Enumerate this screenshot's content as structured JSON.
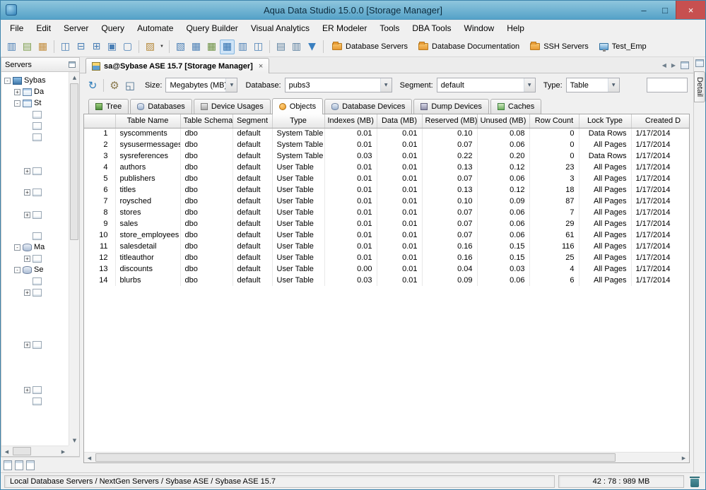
{
  "window": {
    "title": "Aqua Data Studio 15.0.0 [Storage Manager]",
    "controls": {
      "minimize": "–",
      "maximize": "□",
      "close": "×"
    }
  },
  "menubar": [
    "File",
    "Edit",
    "Server",
    "Query",
    "Automate",
    "Query Builder",
    "Visual Analytics",
    "ER Modeler",
    "Tools",
    "DBA Tools",
    "Window",
    "Help"
  ],
  "toolbar": {
    "icons": [
      {
        "name": "register-server-icon",
        "glyph": "▥",
        "color": "#4a7fb5"
      },
      {
        "name": "server-properties-icon",
        "glyph": "▤",
        "color": "#7a9c49"
      },
      {
        "name": "import-servers-icon",
        "glyph": "▦",
        "color": "#c28b3a"
      },
      {
        "name": "separator"
      },
      {
        "name": "cascade-windows-icon",
        "glyph": "◫",
        "color": "#4a7fb5"
      },
      {
        "name": "tile-horizontal-icon",
        "glyph": "⊟",
        "color": "#4a7fb5"
      },
      {
        "name": "tile-vertical-icon",
        "glyph": "⊞",
        "color": "#4a7fb5"
      },
      {
        "name": "expand-window-icon",
        "glyph": "▣",
        "color": "#4a7fb5"
      },
      {
        "name": "restore-window-icon",
        "glyph": "▢",
        "color": "#4a7fb5"
      },
      {
        "name": "separator"
      },
      {
        "name": "paste-icon",
        "glyph": "▨",
        "color": "#b5893c",
        "caret": true
      },
      {
        "name": "separator"
      },
      {
        "name": "query-analyzer-icon",
        "glyph": "▧",
        "color": "#4a7fb5"
      },
      {
        "name": "grid-results-icon",
        "glyph": "▦",
        "color": "#4a7fb5"
      },
      {
        "name": "pivot-grid-icon",
        "glyph": "▦",
        "color": "#6a8f3f"
      },
      {
        "name": "storage-manager-icon",
        "glyph": "▦",
        "color": "#2f6fae",
        "active": true
      },
      {
        "name": "chart-view-icon",
        "glyph": "▥",
        "color": "#4a7fb5"
      },
      {
        "name": "form-view-icon",
        "glyph": "◫",
        "color": "#4a7fb5"
      },
      {
        "name": "separator"
      },
      {
        "name": "row-list-icon",
        "glyph": "▤",
        "color": "#5a7f9f"
      },
      {
        "name": "column-list-icon",
        "glyph": "▥",
        "color": "#5a7f9f"
      },
      {
        "name": "filter-results-icon",
        "glyph": "▼",
        "color": "#3a7fc0"
      },
      {
        "name": "separator"
      }
    ],
    "links": [
      {
        "label": "Database Servers",
        "icon": "folder"
      },
      {
        "label": "Database Documentation",
        "icon": "folder"
      },
      {
        "label": "SSH Servers",
        "icon": "folder"
      },
      {
        "label": "Test_Emp",
        "icon": "monitor"
      }
    ]
  },
  "sidebar": {
    "title": "Servers",
    "tree": [
      {
        "label": "Sybas",
        "icon": "server",
        "expander": "minus",
        "depth": 0,
        "gap": 0
      },
      {
        "label": "Da",
        "icon": "table",
        "expander": "plus",
        "depth": 1,
        "gap": 0
      },
      {
        "label": "St",
        "icon": "table",
        "expander": "minus",
        "depth": 1,
        "gap": 0
      },
      {
        "label": "",
        "icon": "doc",
        "depth": 2,
        "gap": 0
      },
      {
        "label": "",
        "icon": "doc",
        "depth": 2,
        "gap": 0
      },
      {
        "label": "",
        "icon": "doc",
        "depth": 2,
        "gap": 0
      },
      {
        "label": "",
        "icon": "doc",
        "expander": "plus",
        "depth": 2,
        "gap": 32
      },
      {
        "label": "",
        "icon": "doc",
        "expander": "plus",
        "depth": 2,
        "gap": 14
      },
      {
        "label": "",
        "icon": "doc",
        "expander": "plus",
        "depth": 2,
        "gap": 16
      },
      {
        "label": "",
        "icon": "doc",
        "depth": 2,
        "gap": 14
      },
      {
        "label": "Ma",
        "icon": "db",
        "expander": "minus",
        "depth": 1,
        "gap": 0
      },
      {
        "label": "",
        "icon": "doc",
        "expander": "plus",
        "depth": 2,
        "gap": 0
      },
      {
        "label": "Se",
        "icon": "db",
        "expander": "minus",
        "depth": 1,
        "gap": 0
      },
      {
        "label": "",
        "icon": "doc",
        "depth": 2,
        "gap": 0
      },
      {
        "label": "",
        "icon": "doc",
        "expander": "plus",
        "depth": 2,
        "gap": 0
      },
      {
        "label": "",
        "icon": "doc",
        "expander": "plus",
        "depth": 2,
        "gap": 58
      },
      {
        "label": "",
        "icon": "doc",
        "expander": "plus",
        "depth": 2,
        "gap": 48
      },
      {
        "label": "",
        "icon": "doc",
        "depth": 2,
        "gap": 0
      }
    ]
  },
  "doc_tab": {
    "label": "sa@Sybase ASE 15.7 [Storage Manager]",
    "close": "×"
  },
  "controls": {
    "icons": [
      {
        "name": "refresh-icon",
        "glyph": "↻",
        "color": "#2b7bb9"
      },
      {
        "name": "separator"
      },
      {
        "name": "settings-icon",
        "glyph": "⚙",
        "color": "#8a7a4f"
      },
      {
        "name": "copy-grid-icon",
        "glyph": "◱",
        "color": "#4a6f8f"
      }
    ],
    "size_label": "Size:",
    "size_value": "Megabytes (MB)",
    "database_label": "Database:",
    "database_value": "pubs3",
    "segment_label": "Segment:",
    "segment_value": "default",
    "type_label": "Type:",
    "type_value": "Table",
    "filter_value": ""
  },
  "subtabs": [
    {
      "label": "Tree",
      "icon": "tree"
    },
    {
      "label": "Databases",
      "icon": "databases"
    },
    {
      "label": "Device Usages",
      "icon": "devices"
    },
    {
      "label": "Objects",
      "icon": "objects",
      "active": true
    },
    {
      "label": "Database Devices",
      "icon": "db-devices"
    },
    {
      "label": "Dump Devices",
      "icon": "dump"
    },
    {
      "label": "Caches",
      "icon": "caches"
    }
  ],
  "grid": {
    "headers": [
      "",
      "Table Name",
      "Table Schema",
      "Segment",
      "Type",
      "Indexes (MB)",
      "Data (MB)",
      "Reserved (MB)",
      "Unused (MB)",
      "Row Count",
      "Lock Type",
      "Created D"
    ],
    "rows": [
      [
        "1",
        "syscomments",
        "dbo",
        "default",
        "System Table",
        "0.01",
        "0.01",
        "0.10",
        "0.08",
        "0",
        "Data Rows",
        "1/17/2014"
      ],
      [
        "2",
        "sysusermessages",
        "dbo",
        "default",
        "System Table",
        "0.01",
        "0.01",
        "0.07",
        "0.06",
        "0",
        "All Pages",
        "1/17/2014"
      ],
      [
        "3",
        "sysreferences",
        "dbo",
        "default",
        "System Table",
        "0.03",
        "0.01",
        "0.22",
        "0.20",
        "0",
        "Data Rows",
        "1/17/2014"
      ],
      [
        "4",
        "authors",
        "dbo",
        "default",
        "User Table",
        "0.01",
        "0.01",
        "0.13",
        "0.12",
        "23",
        "All Pages",
        "1/17/2014"
      ],
      [
        "5",
        "publishers",
        "dbo",
        "default",
        "User Table",
        "0.01",
        "0.01",
        "0.07",
        "0.06",
        "3",
        "All Pages",
        "1/17/2014"
      ],
      [
        "6",
        "titles",
        "dbo",
        "default",
        "User Table",
        "0.01",
        "0.01",
        "0.13",
        "0.12",
        "18",
        "All Pages",
        "1/17/2014"
      ],
      [
        "7",
        "roysched",
        "dbo",
        "default",
        "User Table",
        "0.01",
        "0.01",
        "0.10",
        "0.09",
        "87",
        "All Pages",
        "1/17/2014"
      ],
      [
        "8",
        "stores",
        "dbo",
        "default",
        "User Table",
        "0.01",
        "0.01",
        "0.07",
        "0.06",
        "7",
        "All Pages",
        "1/17/2014"
      ],
      [
        "9",
        "sales",
        "dbo",
        "default",
        "User Table",
        "0.01",
        "0.01",
        "0.07",
        "0.06",
        "29",
        "All Pages",
        "1/17/2014"
      ],
      [
        "10",
        "store_employees",
        "dbo",
        "default",
        "User Table",
        "0.01",
        "0.01",
        "0.07",
        "0.06",
        "61",
        "All Pages",
        "1/17/2014"
      ],
      [
        "11",
        "salesdetail",
        "dbo",
        "default",
        "User Table",
        "0.01",
        "0.01",
        "0.16",
        "0.15",
        "116",
        "All Pages",
        "1/17/2014"
      ],
      [
        "12",
        "titleauthor",
        "dbo",
        "default",
        "User Table",
        "0.01",
        "0.01",
        "0.16",
        "0.15",
        "25",
        "All Pages",
        "1/17/2014"
      ],
      [
        "13",
        "discounts",
        "dbo",
        "default",
        "User Table",
        "0.00",
        "0.01",
        "0.04",
        "0.03",
        "4",
        "All Pages",
        "1/17/2014"
      ],
      [
        "14",
        "blurbs",
        "dbo",
        "default",
        "User Table",
        "0.03",
        "0.01",
        "0.09",
        "0.06",
        "6",
        "All Pages",
        "1/17/2014"
      ]
    ]
  },
  "detail_tab": "Detail",
  "statusbar": {
    "left": "Local Database Servers / NextGen Servers / Sybase ASE / Sybase ASE 15.7",
    "right": "42 : 78 : 989 MB"
  }
}
